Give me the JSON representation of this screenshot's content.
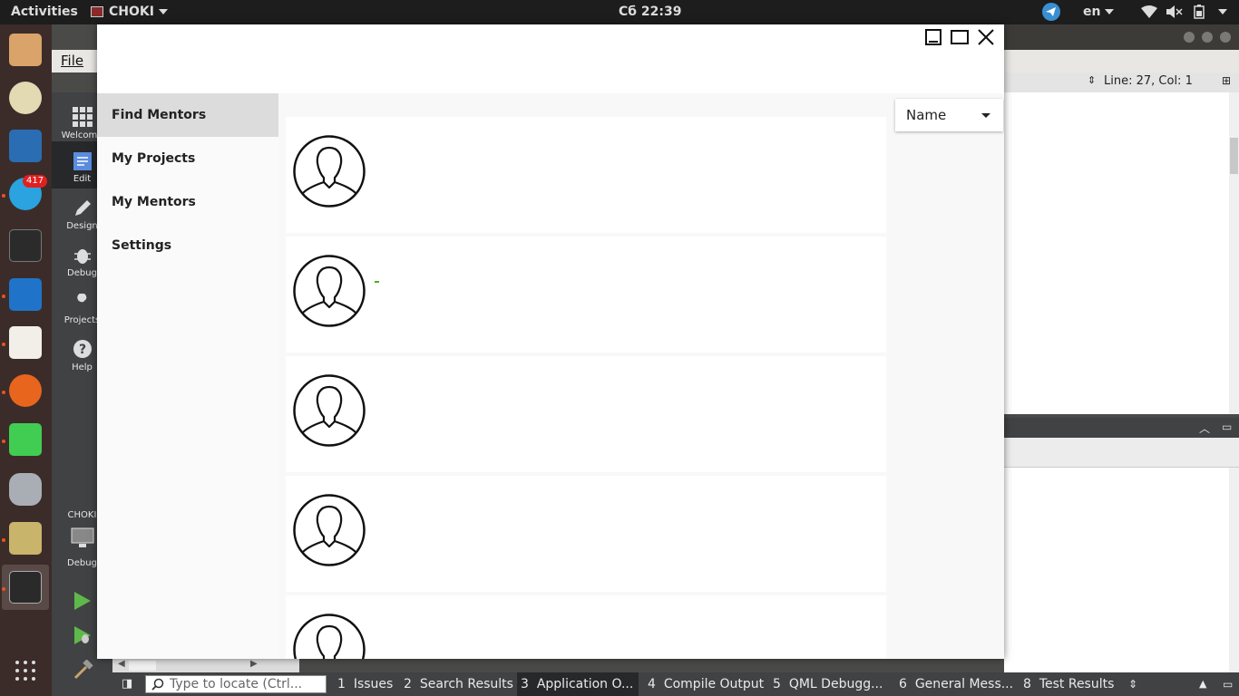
{
  "topbar": {
    "activities": "Activities",
    "app_name": "CHOKI",
    "clock": "Сб 22:39",
    "telegram_badge": "417",
    "lang": "en"
  },
  "dock": {
    "telegram_badge": "417"
  },
  "qt": {
    "menu_file": "File",
    "line_col": "Line: 27, Col: 1",
    "modes": [
      "Welcome",
      "Edit",
      "Design",
      "Debug",
      "Projects",
      "Help"
    ],
    "target_project": "CHOKI",
    "target_mode": "Debug",
    "locate_placeholder": "Type to locate (Ctrl...",
    "bottom_tabs": [
      {
        "num": "1",
        "label": "Issues"
      },
      {
        "num": "2",
        "label": "Search Results"
      },
      {
        "num": "3",
        "label": "Application O..."
      },
      {
        "num": "4",
        "label": "Compile Output"
      },
      {
        "num": "5",
        "label": "QML Debugg..."
      },
      {
        "num": "6",
        "label": "General Mess..."
      },
      {
        "num": "8",
        "label": "Test Results"
      }
    ]
  },
  "app": {
    "nav": [
      {
        "label": "Find Mentors",
        "active": true
      },
      {
        "label": "My Projects",
        "active": false
      },
      {
        "label": "My Mentors",
        "active": false
      },
      {
        "label": "Settings",
        "active": false
      }
    ],
    "sort": {
      "selected": "Name"
    },
    "mentor_count_visible": 5
  },
  "colors": {
    "accent_orange": "#e95420",
    "active_nav": "#dcdcdc",
    "qt_dark": "#404244"
  }
}
